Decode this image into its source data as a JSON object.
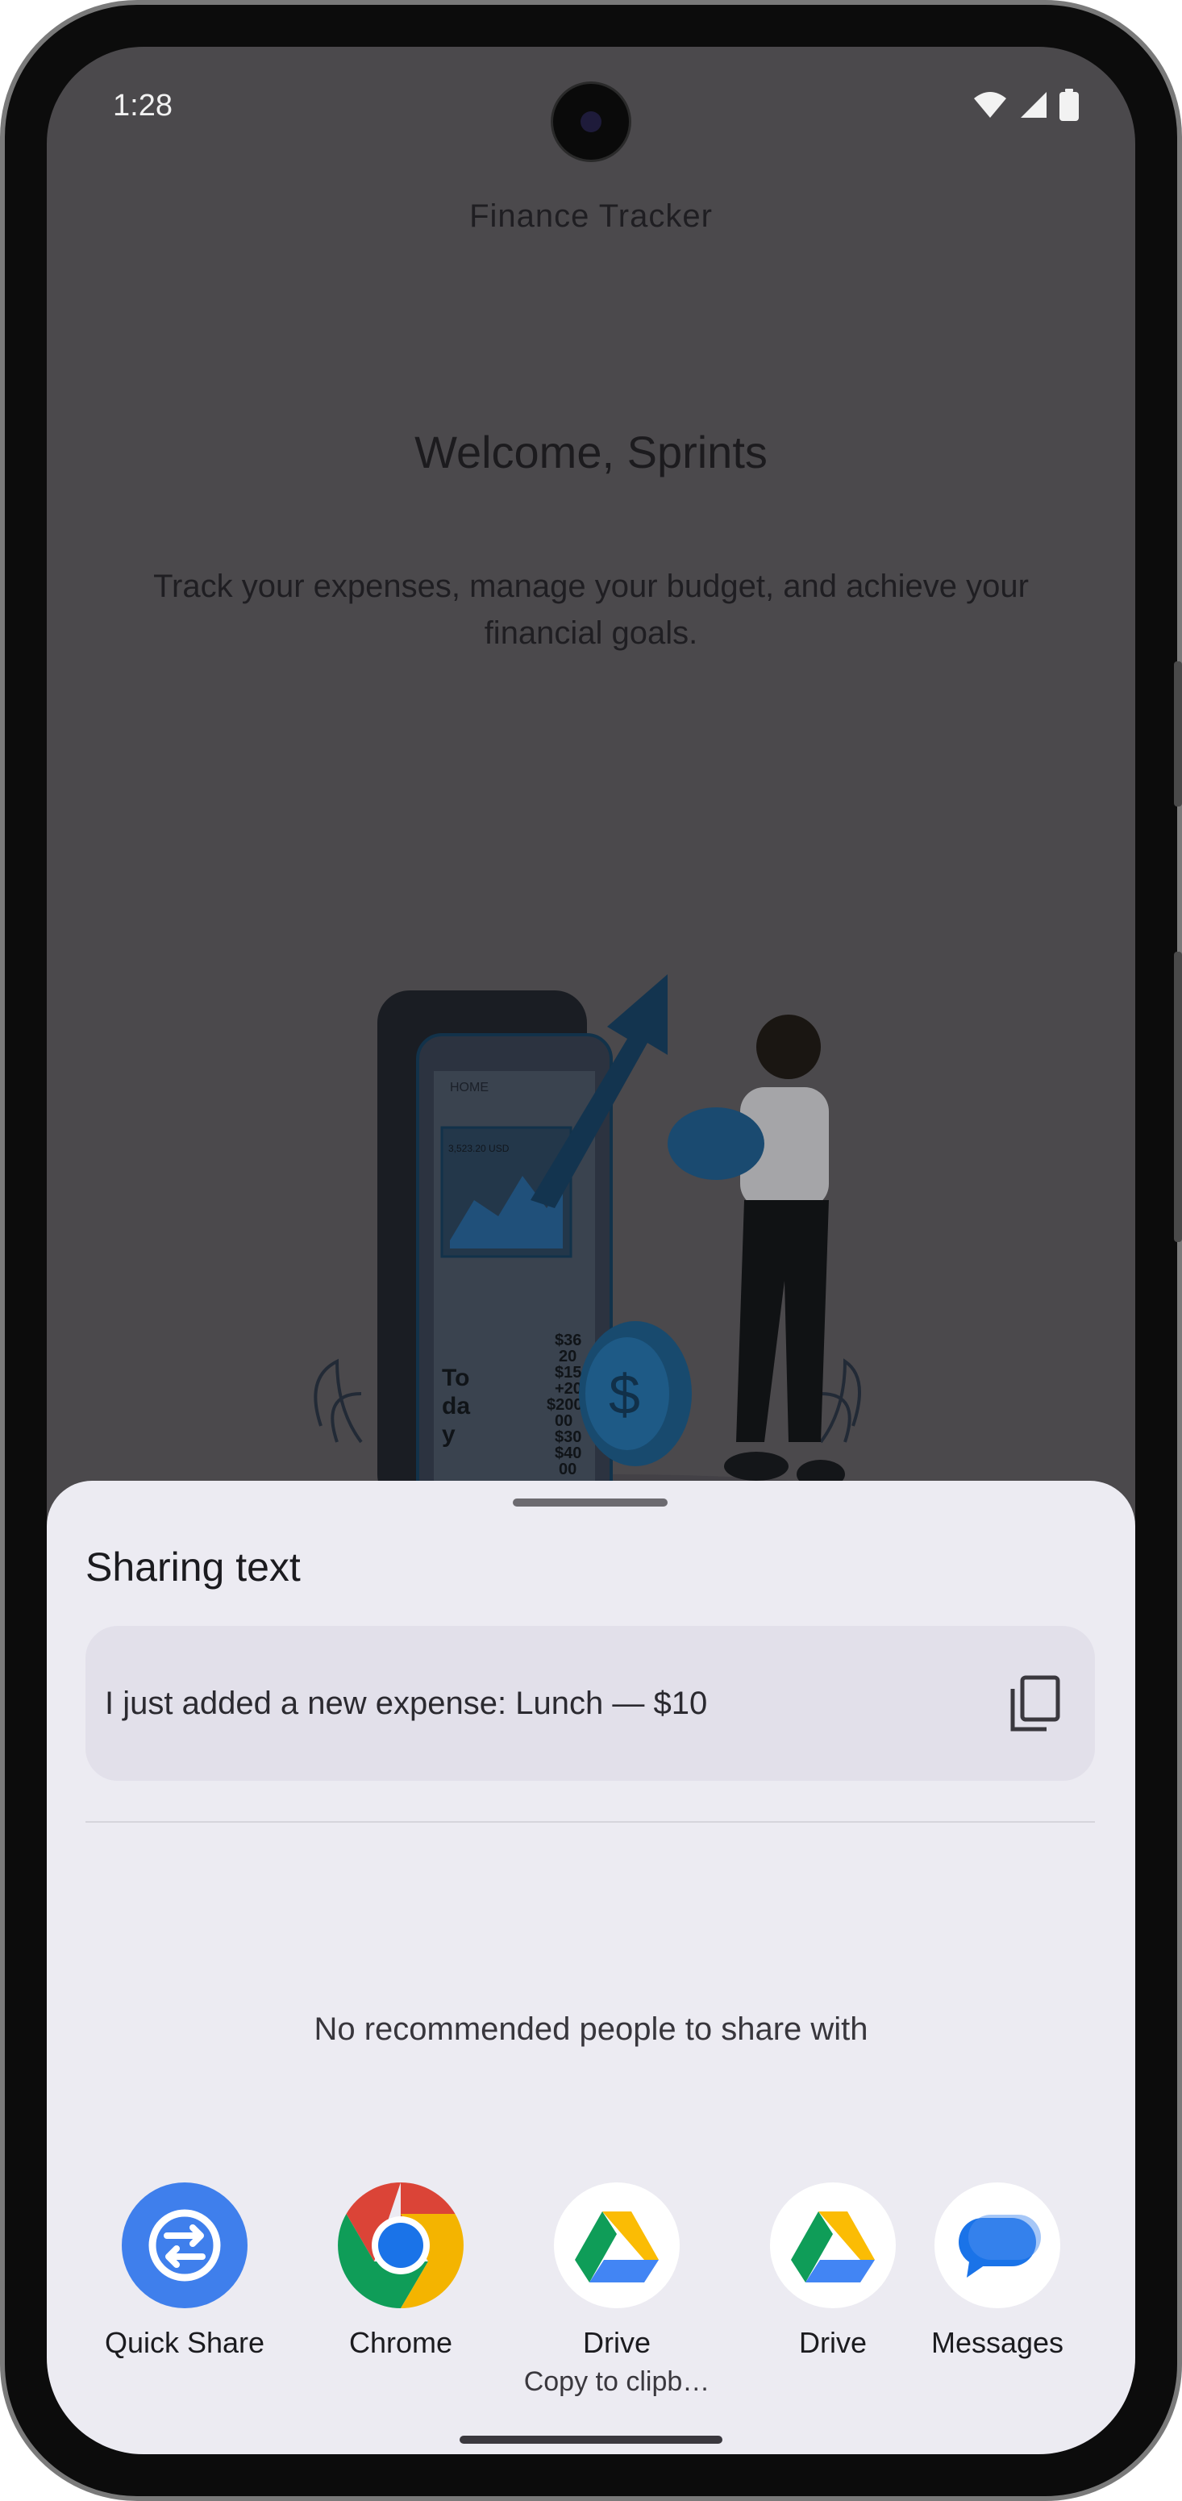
{
  "status_bar": {
    "time": "1:28",
    "icons": [
      "wifi-icon",
      "signal-icon",
      "battery-icon"
    ]
  },
  "app": {
    "title": "Finance Tracker",
    "welcome": "Welcome, Sprints",
    "tagline": "Track your expenses, manage your budget, and achieve your financial goals."
  },
  "illustration": {
    "phone_header": "HOME",
    "phone_amount": "3,523.20 USD",
    "phone_side_text": [
      "To",
      "da",
      "y"
    ],
    "phone_values": [
      "$36",
      "20",
      "$15",
      "+20",
      "$200",
      "00",
      "$30",
      "$40",
      "00"
    ]
  },
  "share_sheet": {
    "title": "Sharing text",
    "shared_text": "I just added a new expense: Lunch — $10",
    "copy_icon": "copy-icon",
    "no_recommendations": "No recommended people to share with",
    "targets": [
      {
        "label": "Quick Share",
        "sublabel": "",
        "icon": "quick-share-icon",
        "color": "#3f7fec"
      },
      {
        "label": "Chrome",
        "sublabel": "",
        "icon": "chrome-icon",
        "color": "#ffffff"
      },
      {
        "label": "Drive",
        "sublabel": "Copy to clipb…",
        "icon": "drive-icon",
        "color": "#ffffff"
      },
      {
        "label": "Drive",
        "sublabel": "",
        "icon": "drive-icon",
        "color": "#ffffff"
      },
      {
        "label": "Messages",
        "sublabel": "",
        "icon": "messages-icon",
        "color": "#ffffff"
      }
    ]
  },
  "colors": {
    "scrim_background": "#4b494c",
    "sheet_background": "#ecebf2",
    "share_box": "#e2e0ea",
    "accent_blue": "#1a73e8"
  }
}
